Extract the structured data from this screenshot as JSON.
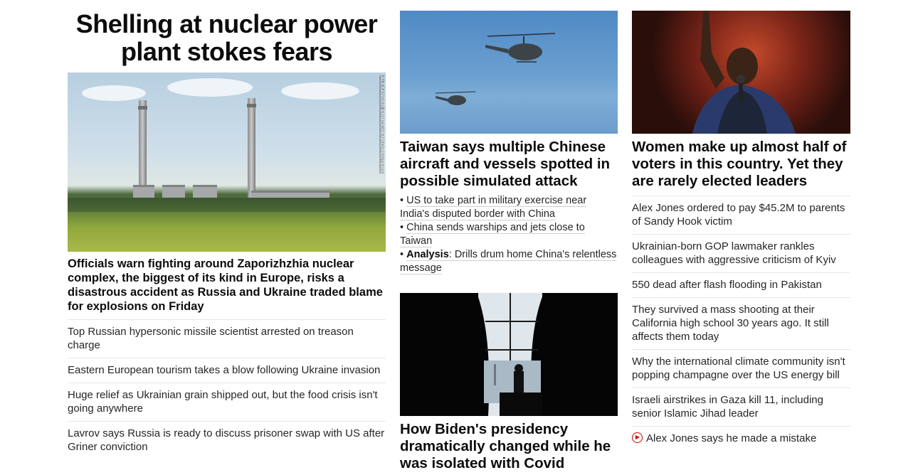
{
  "col1": {
    "headline": "Shelling at nuclear power plant stokes fears",
    "photo_credit": "ALEXANDER ERMOCHENKO/REUTERS",
    "summary": "Officials warn fighting around Zaporizhzhia nuclear complex, the biggest of its kind in Europe, risks a disastrous accident as Russia and Ukraine traded blame for explosions on Friday",
    "stories": [
      "Top Russian hypersonic missile scientist arrested on treason charge",
      "Eastern European tourism takes a blow following Ukraine invasion",
      "Huge relief as Ukrainian grain shipped out, but the food crisis isn't going anywhere",
      "Lavrov says Russia is ready to discuss prisoner swap with US after Griner conviction"
    ]
  },
  "col2": {
    "top_headline": "Taiwan says multiple Chinese aircraft and vessels spotted in possible simulated attack",
    "bullets": [
      {
        "prefix": "• ",
        "bold": "",
        "text": "US to take part in military exercise near India's disputed border with China"
      },
      {
        "prefix": "• ",
        "bold": "",
        "text": "China sends warships and jets close to Taiwan"
      },
      {
        "prefix": "• ",
        "bold": "Analysis",
        "text": ": Drills drum home China's relentless message"
      }
    ],
    "bottom_headline": "How Biden's presidency dramatically changed while he was isolated with Covid"
  },
  "col3": {
    "headline": "Women make up almost half of voters in this country. Yet they are rarely elected leaders",
    "stories": [
      "Alex Jones ordered to pay $45.2M to parents of Sandy Hook victim",
      "Ukrainian-born GOP lawmaker rankles colleagues with aggressive criticism of Kyiv",
      "550 dead after flash flooding in Pakistan",
      "They survived a mass shooting at their California high school 30 years ago. It still affects them today",
      "Why the international climate community isn't popping champagne over the US energy bill",
      "Israeli airstrikes in Gaza kill 11, including senior Islamic Jihad leader"
    ],
    "video_story": "Alex Jones says he made a mistake"
  },
  "colors": {
    "text": "#0c0c0c",
    "divider": "#e6e6e6",
    "video_accent": "#cc0000"
  }
}
